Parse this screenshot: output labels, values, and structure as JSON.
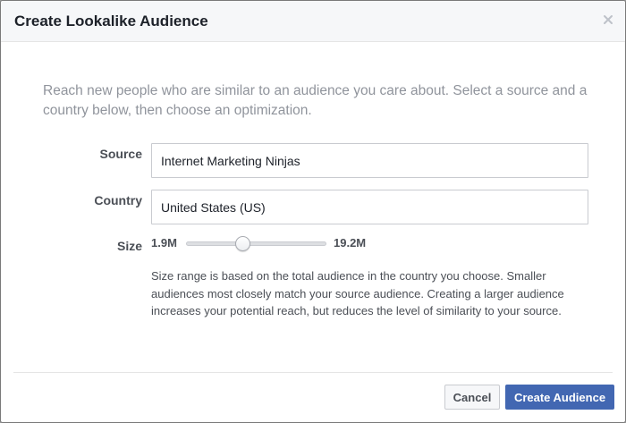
{
  "dialog": {
    "title": "Create Lookalike Audience",
    "intro": "Reach new people who are similar to an audience you care about. Select a source and a country below, then choose an optimization."
  },
  "source": {
    "label": "Source",
    "value": "Internet Marketing Ninjas"
  },
  "country": {
    "label": "Country",
    "value": "United States (US)"
  },
  "size": {
    "label": "Size",
    "min_label": "1.9M",
    "max_label": "19.2M",
    "slider_fraction": 0.4,
    "help": "Size range is based on the total audience in the country you choose. Smaller audiences most closely match your source audience. Creating a larger audience increases your potential reach, but reduces the level of similarity to your source."
  },
  "footer": {
    "cancel_label": "Cancel",
    "create_label": "Create Audience"
  },
  "icons": {
    "close": "close-icon"
  },
  "colors": {
    "primary": "#4267b2",
    "header_bg": "#f6f7f9",
    "intro_text": "#90949c"
  }
}
